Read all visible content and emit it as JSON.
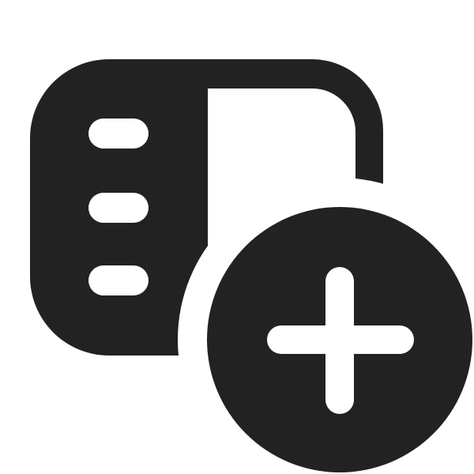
{
  "icon": {
    "name": "document-list-add-icon",
    "parts": [
      "document-panel",
      "list-lines",
      "add-circle",
      "plus-sign"
    ]
  },
  "colors": {
    "background": "#ffffff",
    "foreground": "#222222"
  }
}
